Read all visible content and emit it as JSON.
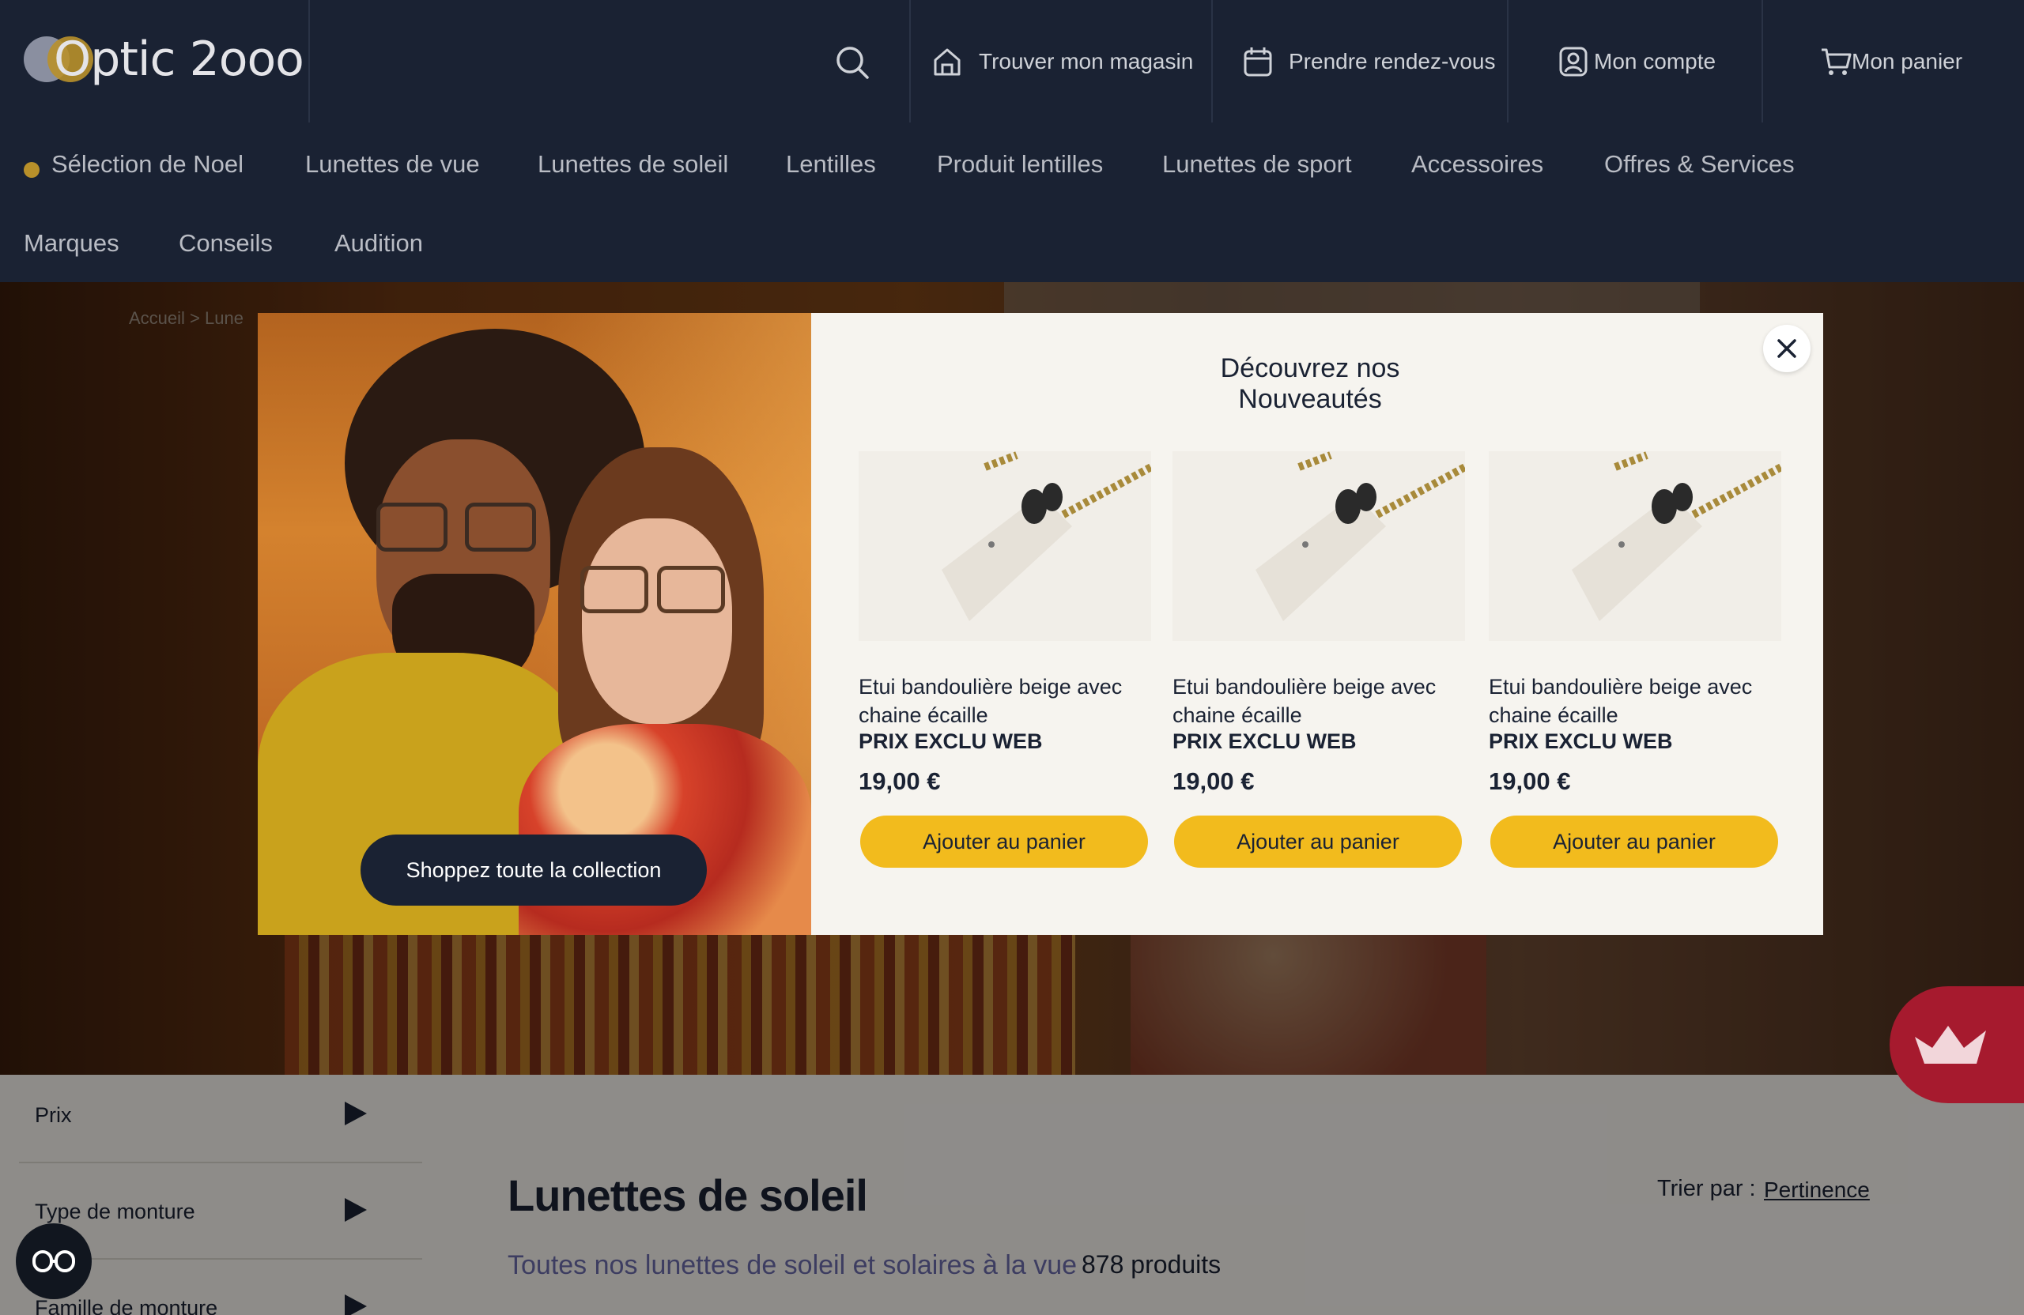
{
  "header": {
    "logo_text": "Optic 2ooo",
    "search_icon": "search-icon",
    "nav": [
      {
        "label": "Trouver mon magasin",
        "icon": "store-icon"
      },
      {
        "label": "Prendre rendez-vous",
        "icon": "calendar-icon"
      },
      {
        "label": "Mon compte",
        "icon": "account-icon"
      },
      {
        "label": "Mon panier",
        "icon": "cart-icon"
      }
    ]
  },
  "menu": {
    "row1": [
      "Sélection de Noel",
      "Lunettes de vue",
      "Lunettes de soleil",
      "Lentilles",
      "Produit lentilles",
      "Lunettes de sport",
      "Accessoires",
      "Offres & Services"
    ],
    "row2": [
      "Marques",
      "Conseils",
      "Audition"
    ]
  },
  "breadcrumb": {
    "home": "Accueil",
    "current_partial": "Lune"
  },
  "modal": {
    "title": "Découvrez nos Nouveautés",
    "shop_button": "Shoppez toute la collection",
    "products": [
      {
        "name": "Etui bandoulière beige avec chaine écaille",
        "tag": "PRIX EXCLU WEB",
        "price": "19,00 €",
        "button": "Ajouter au panier"
      },
      {
        "name": "Etui bandoulière beige avec chaine écaille",
        "tag": "PRIX EXCLU WEB",
        "price": "19,00 €",
        "button": "Ajouter au panier"
      },
      {
        "name": "Etui bandoulière beige avec chaine écaille",
        "tag": "PRIX EXCLU WEB",
        "price": "19,00 €",
        "button": "Ajouter au panier"
      }
    ]
  },
  "filters": [
    "Prix",
    "Type de monture",
    "Famille de monture"
  ],
  "listing": {
    "title": "Lunettes de soleil",
    "subtitle": "Toutes nos lunettes de soleil et solaires à la vue",
    "count": "878 produits",
    "sort_label": "Trier par :",
    "sort_value": "Pertinence"
  },
  "colors": {
    "navy": "#1a2233",
    "accent_yellow": "#f2bb1d",
    "gold": "#b8902a",
    "loyalty_red": "#a61a2e"
  }
}
